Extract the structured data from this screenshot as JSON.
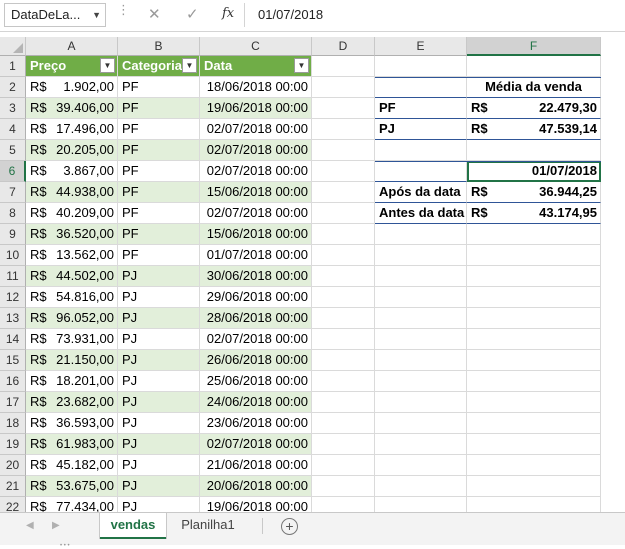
{
  "formula_bar": {
    "name_box": "DataDeLa...",
    "cancel_icon": "✕",
    "enter_icon": "✓",
    "fx_label": "fx",
    "value": "01/07/2018"
  },
  "columns": [
    "A",
    "B",
    "C",
    "D",
    "E",
    "F"
  ],
  "selected_column": "F",
  "selected_row": "6",
  "row_numbers": [
    "1",
    "2",
    "3",
    "4",
    "5",
    "6",
    "7",
    "8",
    "9",
    "10",
    "11",
    "12",
    "13",
    "14",
    "15",
    "16",
    "17",
    "18",
    "19",
    "20",
    "21",
    "22"
  ],
  "table": {
    "headers": [
      "Preço",
      "Categoria",
      "Data"
    ],
    "filter_icon": "▼",
    "rows": [
      {
        "cur": "R$",
        "amt": "1.902,00",
        "cat": "PF",
        "date": "18/06/2018 00:00"
      },
      {
        "cur": "R$",
        "amt": "39.406,00",
        "cat": "PF",
        "date": "19/06/2018 00:00"
      },
      {
        "cur": "R$",
        "amt": "17.496,00",
        "cat": "PF",
        "date": "02/07/2018 00:00"
      },
      {
        "cur": "R$",
        "amt": "20.205,00",
        "cat": "PF",
        "date": "02/07/2018 00:00"
      },
      {
        "cur": "R$",
        "amt": "3.867,00",
        "cat": "PF",
        "date": "02/07/2018 00:00"
      },
      {
        "cur": "R$",
        "amt": "44.938,00",
        "cat": "PF",
        "date": "15/06/2018 00:00"
      },
      {
        "cur": "R$",
        "amt": "40.209,00",
        "cat": "PF",
        "date": "02/07/2018 00:00"
      },
      {
        "cur": "R$",
        "amt": "36.520,00",
        "cat": "PF",
        "date": "15/06/2018 00:00"
      },
      {
        "cur": "R$",
        "amt": "13.562,00",
        "cat": "PF",
        "date": "01/07/2018 00:00"
      },
      {
        "cur": "R$",
        "amt": "44.502,00",
        "cat": "PJ",
        "date": "30/06/2018 00:00"
      },
      {
        "cur": "R$",
        "amt": "54.816,00",
        "cat": "PJ",
        "date": "29/06/2018 00:00"
      },
      {
        "cur": "R$",
        "amt": "96.052,00",
        "cat": "PJ",
        "date": "28/06/2018 00:00"
      },
      {
        "cur": "R$",
        "amt": "73.931,00",
        "cat": "PJ",
        "date": "02/07/2018 00:00"
      },
      {
        "cur": "R$",
        "amt": "21.150,00",
        "cat": "PJ",
        "date": "26/06/2018 00:00"
      },
      {
        "cur": "R$",
        "amt": "18.201,00",
        "cat": "PJ",
        "date": "25/06/2018 00:00"
      },
      {
        "cur": "R$",
        "amt": "23.682,00",
        "cat": "PJ",
        "date": "24/06/2018 00:00"
      },
      {
        "cur": "R$",
        "amt": "36.593,00",
        "cat": "PJ",
        "date": "23/06/2018 00:00"
      },
      {
        "cur": "R$",
        "amt": "61.983,00",
        "cat": "PJ",
        "date": "02/07/2018 00:00"
      },
      {
        "cur": "R$",
        "amt": "45.182,00",
        "cat": "PJ",
        "date": "21/06/2018 00:00"
      },
      {
        "cur": "R$",
        "amt": "53.675,00",
        "cat": "PJ",
        "date": "20/06/2018 00:00"
      },
      {
        "cur": "R$",
        "amt": "77.434,00",
        "cat": "PJ",
        "date": "19/06/2018 00:00"
      }
    ]
  },
  "summary": {
    "title": "Média da venda",
    "pf_label": "PF",
    "pf_cur": "R$",
    "pf_value": "22.479,30",
    "pj_label": "PJ",
    "pj_cur": "R$",
    "pj_value": "47.539,14",
    "date_value": "01/07/2018",
    "after_label": "Após da data",
    "after_cur": "R$",
    "after_value": "36.944,25",
    "before_label": "Antes da data",
    "before_cur": "R$",
    "before_value": "43.174,95"
  },
  "sheets": {
    "tabs": [
      "vendas",
      "Planilha1"
    ],
    "active": "vendas",
    "add_icon": "+"
  },
  "colors": {
    "header_green": "#70ad47",
    "band_green": "#e2efda",
    "excel_green": "#217346",
    "summary_border": "#2f5597"
  }
}
